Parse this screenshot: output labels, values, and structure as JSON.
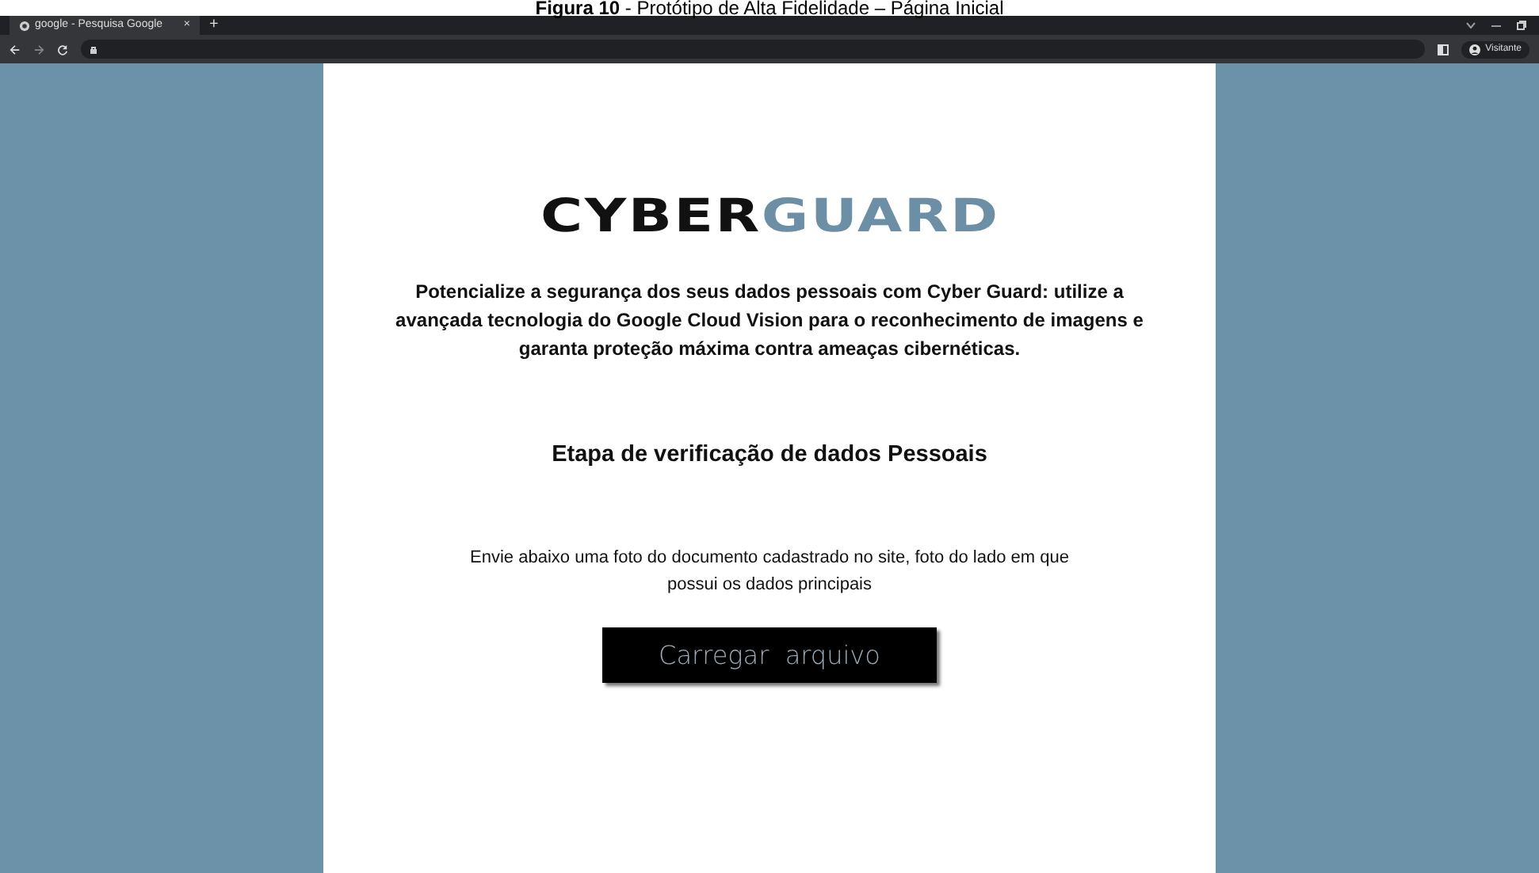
{
  "caption": {
    "label": "Figura 10",
    "title": " - Protótipo de Alta Fidelidade – Página Inicial"
  },
  "browser": {
    "tabs": [
      {
        "title": "google - Pesquisa Google",
        "close": "×",
        "selected": true
      }
    ],
    "new_tab": "+",
    "profile": "Visitante"
  },
  "page": {
    "logo": [
      {
        "text": "CYBER",
        "color": "#111111"
      },
      {
        "text": "GUARD",
        "color": "#6c8fa6"
      }
    ],
    "intro": "Potencialize a segurança dos seus dados pessoais com Cyber Guard: utilize a avançada tecnologia do Google Cloud Vision para o reconhecimento de imagens e garanta proteção máxima contra ameaças cibernéticas.",
    "heading": "Etapa de verificação de dados Pessoais",
    "instruction": "Envie abaixo uma foto do documento cadastrado no site, foto do lado em que possui os dados principais",
    "button": "Carregar  arquivo"
  }
}
